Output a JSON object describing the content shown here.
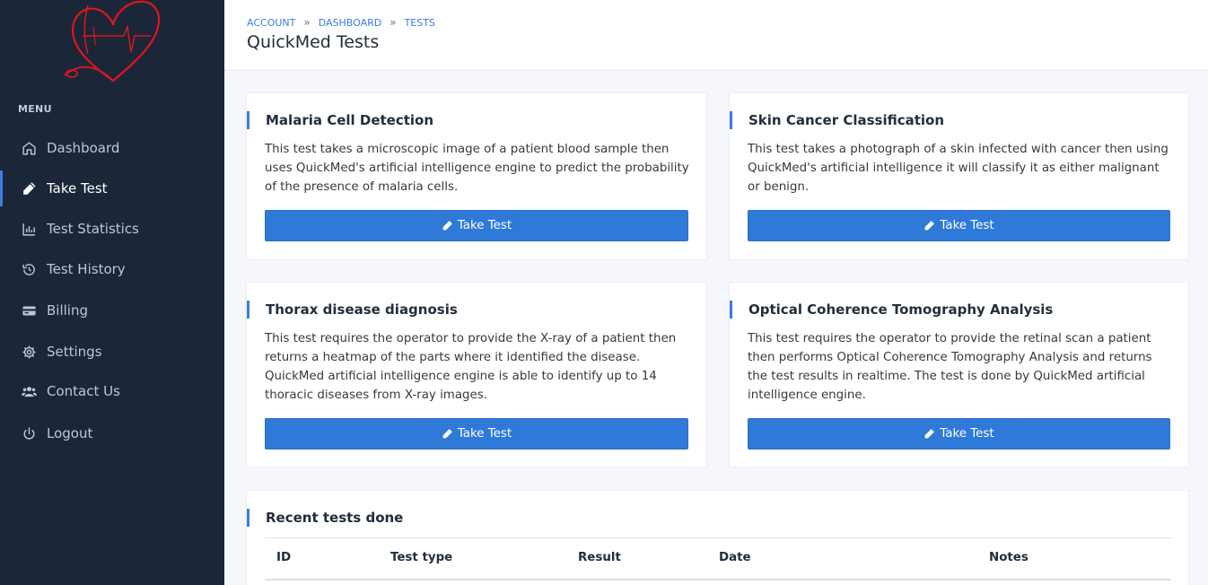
{
  "sidebar": {
    "menu_header": "MENU",
    "items": [
      {
        "label": "Dashboard",
        "icon": "home-icon"
      },
      {
        "label": "Take Test",
        "icon": "pencil-icon",
        "active": true
      },
      {
        "label": "Test Statistics",
        "icon": "bar-chart-icon"
      },
      {
        "label": "Test History",
        "icon": "history-icon"
      },
      {
        "label": "Billing",
        "icon": "credit-card-icon"
      },
      {
        "label": "Settings",
        "icon": "gear-icon"
      },
      {
        "label": "Contact Us",
        "icon": "users-icon"
      },
      {
        "label": "Logout",
        "icon": "power-icon"
      }
    ]
  },
  "header": {
    "breadcrumb": [
      "ACCOUNT",
      "DASHBOARD",
      "TESTS"
    ],
    "title": "QuickMed Tests"
  },
  "tests": [
    {
      "title": "Malaria Cell Detection",
      "description": "This test takes a microscopic image of a patient blood sample then uses QuickMed's artificial intelligence engine to predict the probability of the presence of malaria cells.",
      "button_label": "Take Test"
    },
    {
      "title": "Skin Cancer Classification",
      "description": "This test takes a photograph of a skin infected with cancer then using QuickMed's artificial intelligence it will classify it as either malignant or benign.",
      "button_label": "Take Test"
    },
    {
      "title": "Thorax disease diagnosis",
      "description": "This test requires the operator to provide the X-ray of a patient then returns a heatmap of the parts where it identified the disease. QuickMed artificial intelligence engine is able to identify up to 14 thoracic diseases from X-ray images.",
      "button_label": "Take Test"
    },
    {
      "title": "Optical Coherence Tomography Analysis",
      "description": "This test requires the operator to provide the retinal scan a patient then performs Optical Coherence Tomography Analysis and returns the test results in realtime. The test is done by QuickMed artificial intelligence engine.",
      "button_label": "Take Test"
    }
  ],
  "recent": {
    "title": "Recent tests done",
    "columns": [
      "ID",
      "Test type",
      "Result",
      "Date",
      "Notes"
    ]
  },
  "colors": {
    "sidebar_bg": "#1b2639",
    "accent": "#3b7ddd",
    "button": "#2f7ad8",
    "logo": "#e0161c"
  }
}
